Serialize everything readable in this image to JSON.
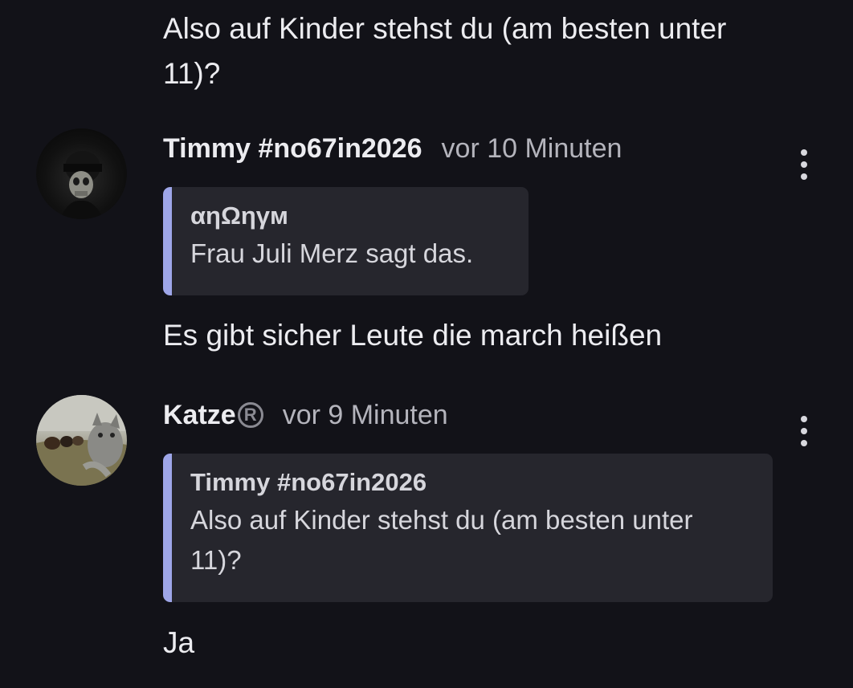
{
  "previous_message": {
    "text": "Also auf Kinder stehst du (am besten unter 11)?"
  },
  "comments": [
    {
      "username": "Timmy #no67in2026",
      "badge": "",
      "timestamp": "vor 10 Minuten",
      "avatar_icon": "skull-avatar",
      "quote": {
        "author": "αηΩηγм",
        "text": "Frau Juli Merz sagt das."
      },
      "message": "Es gibt sicher Leute die march heißen"
    },
    {
      "username": "Katze",
      "badge": "R",
      "timestamp": "vor 9 Minuten",
      "avatar_icon": "cat-avatar",
      "quote": {
        "author": "Timmy #no67in2026",
        "text": "Also auf Kinder stehst du (am besten unter 11)?"
      },
      "message": "Ja"
    }
  ],
  "colors": {
    "background": "#121218",
    "quote_background": "#26262d",
    "quote_accent": "#9ea6e8",
    "text_primary": "#ececf0",
    "text_secondary": "#b4b4bc"
  },
  "icons": {
    "more_menu": "vertical-ellipsis-icon",
    "registered": "registered-icon"
  }
}
